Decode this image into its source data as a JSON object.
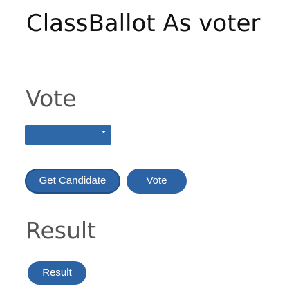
{
  "page": {
    "title": "ClassBallot As voter"
  },
  "vote": {
    "heading": "Vote",
    "select": {
      "value": ""
    },
    "get_candidate_label": "Get Candidate",
    "vote_label": "Vote"
  },
  "result": {
    "heading": "Result",
    "result_label": "Result"
  },
  "colors": {
    "button": "#2b63a5",
    "heading": "#555555",
    "title": "#111111"
  },
  "icons": {
    "select_arrow": "chevron-down-icon"
  }
}
